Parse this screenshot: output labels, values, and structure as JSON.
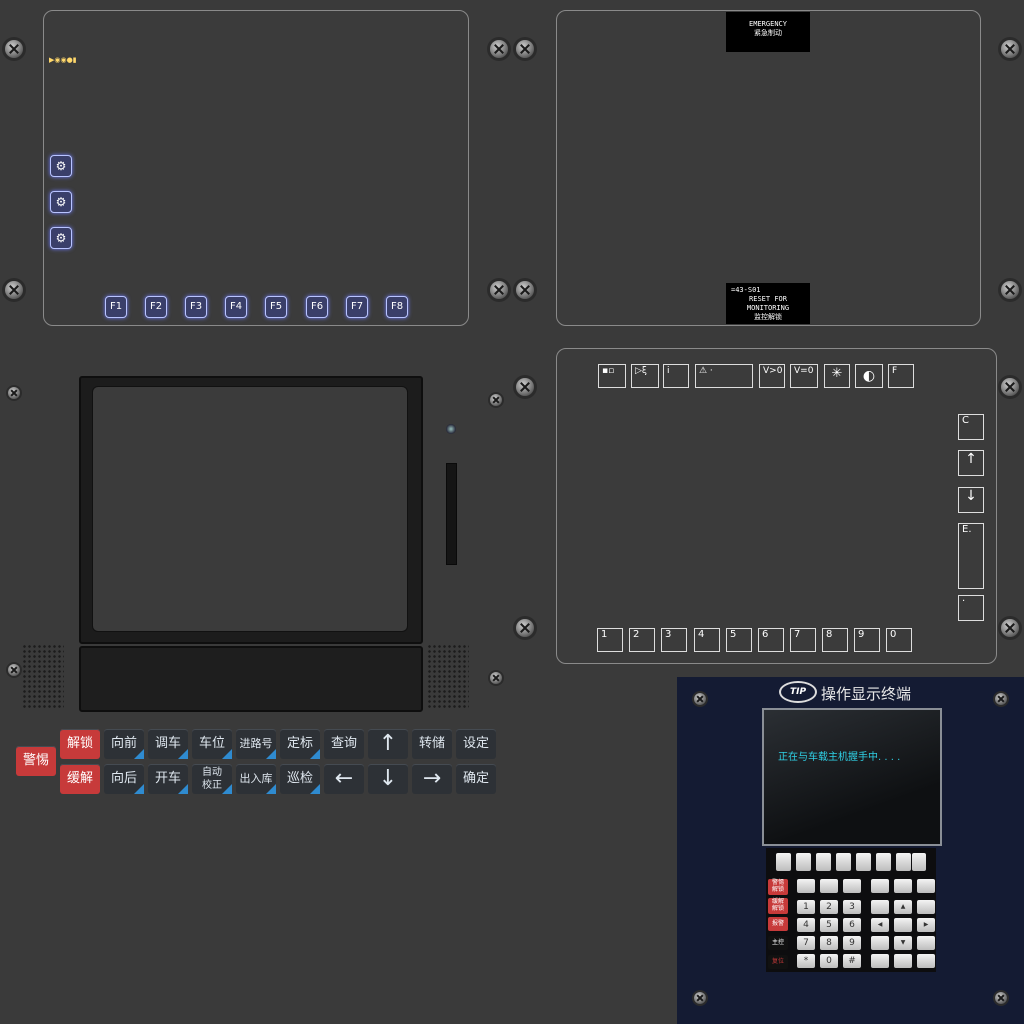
{
  "top_left": {
    "logo_text": "▶◉◉●▮",
    "gear_icon": "⚙",
    "fkeys": [
      "F1",
      "F2",
      "F3",
      "F4",
      "F5",
      "F6",
      "F7",
      "F8"
    ]
  },
  "top_right": {
    "emergency_line1": "EMERGENCY",
    "emergency_line2": "紧急制动",
    "reset_line1": "=43-S01",
    "reset_line2": "RESET FOR",
    "reset_line3": "MONITORING",
    "reset_line4": "监控解锁"
  },
  "right_panel": {
    "top_buttons": [
      "▪▫",
      "▷ξ",
      "i",
      "⚠   ·",
      "V>0",
      "V=0",
      "✳",
      "◐",
      "F"
    ],
    "side_buttons": [
      "C",
      "↑",
      "↓",
      "E.",
      " ·"
    ],
    "numbers": [
      "1",
      "2",
      "3",
      "4",
      "5",
      "6",
      "7",
      "8",
      "9",
      "0"
    ]
  },
  "keypad": {
    "alert": "警惕",
    "unlock": "解锁",
    "slow_release": "缓解",
    "row1": [
      "向前",
      "调车",
      "车位",
      "进路号",
      "定标",
      "查询",
      "↑",
      "转储",
      "设定"
    ],
    "row2": [
      "向后",
      "开车",
      "自动\n校正",
      "出入库",
      "巡检",
      "←",
      "↓",
      "→",
      "确定"
    ]
  },
  "terminal": {
    "brand": "操作显示终端",
    "logo": "TIP",
    "message": "正在与车载主机握手中. . . .",
    "left_keys": [
      "警惕\n解锁",
      "缓解\n解锁",
      "报警",
      "主控",
      "复位"
    ],
    "num_keys": [
      "1",
      "2",
      "3",
      "4",
      "5",
      "6",
      "7",
      "8",
      "9",
      "*",
      "0",
      "#"
    ]
  },
  "colors": {
    "accent_blue": "#2f8bd0",
    "alert_red": "#c73a3a",
    "terminal_text": "#2fd1e6",
    "glow": "#b9c4ff"
  }
}
